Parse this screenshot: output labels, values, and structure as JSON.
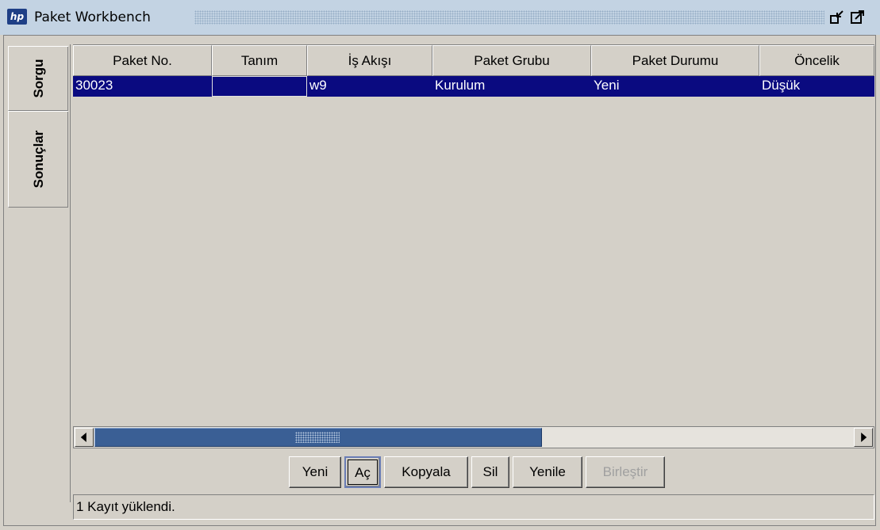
{
  "window": {
    "title": "Paket Workbench",
    "logo_text": "hp"
  },
  "tabs": [
    {
      "label": "Sorgu"
    },
    {
      "label": "Sonuçlar"
    }
  ],
  "table": {
    "columns": [
      "Paket No.",
      "Tanım",
      "İş Akışı",
      "Paket Grubu",
      "Paket Durumu",
      "Öncelik"
    ],
    "rows": [
      {
        "paket_no": "30023",
        "tanim": "",
        "is_akisi": "w9",
        "paket_grubu": "Kurulum",
        "paket_durumu": "Yeni",
        "oncelik": "Düşük",
        "selected": true
      }
    ]
  },
  "buttons": {
    "yeni": "Yeni",
    "ac": "Aç",
    "kopyala": "Kopyala",
    "sil": "Sil",
    "yenile": "Yenile",
    "birlestir": "Birleştir"
  },
  "status": {
    "text": "1 Kayıt yüklendi."
  },
  "colors": {
    "selection": "#0a0a80",
    "title_bar": "#c3d3e3",
    "scroll_thumb": "#3a5f95"
  },
  "icons": [
    "hp-logo-icon",
    "restore-window-icon",
    "maximize-window-icon",
    "scroll-left-icon",
    "scroll-right-icon"
  ]
}
